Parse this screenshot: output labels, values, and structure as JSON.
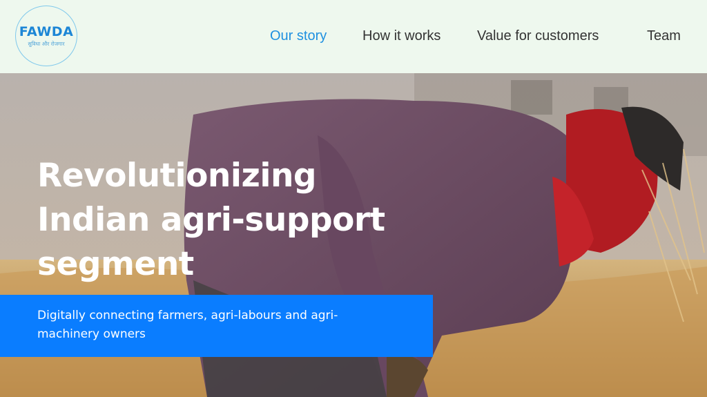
{
  "brand": {
    "name": "FAWDA",
    "tagline": "सुविधा और रोजगार",
    "primary_color": "#1e90e0"
  },
  "nav": {
    "items": [
      {
        "label": "Our story",
        "active": true
      },
      {
        "label": "How it works",
        "active": false
      },
      {
        "label": "Value for customers",
        "active": false
      },
      {
        "label": "Team",
        "active": false
      }
    ]
  },
  "hero": {
    "headline_lines": [
      "Revolutionizing",
      "Indian agri-support",
      "segment"
    ],
    "subtext": "Digitally connecting farmers, agri-labours and agri-machinery owners",
    "banner_color": "#0a7dff",
    "image": "farmer-harvesting-wheat-photo"
  }
}
